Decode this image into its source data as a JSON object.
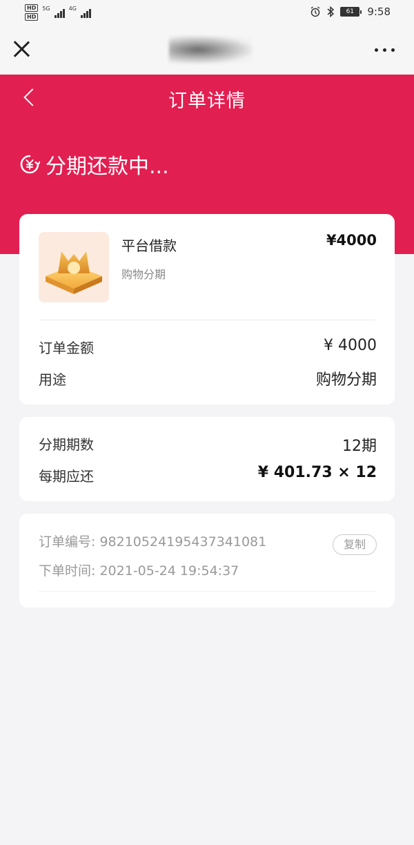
{
  "status_bar": {
    "left_badges": [
      "HD",
      "HD"
    ],
    "net_5g": "5G",
    "net_4g": "4G",
    "battery": "61",
    "time": "9:58"
  },
  "browser_bar": {
    "close_icon": "close-icon",
    "more_icon": "more-icon"
  },
  "header": {
    "title": "订单详情",
    "status_text": "分期还款中..."
  },
  "product": {
    "name": "平台借款",
    "subtitle": "购物分期",
    "price": "¥4000"
  },
  "order_summary": {
    "amount_label": "订单金额",
    "amount_value": "¥ 4000",
    "purpose_label": "用途",
    "purpose_value": "购物分期"
  },
  "installment": {
    "periods_label": "分期期数",
    "periods_value": "12期",
    "per_period_label": "每期应还",
    "per_period_value": "¥ 401.73 × 12"
  },
  "order_meta": {
    "order_no_label": "订单编号:",
    "order_no_value": "98210524195437341081",
    "order_time_label": "下单时间:",
    "order_time_value": "2021-05-24 19:54:37",
    "copy_label": "复制"
  },
  "colors": {
    "brand_red": "#e21f51",
    "background": "#f4f4f6"
  }
}
